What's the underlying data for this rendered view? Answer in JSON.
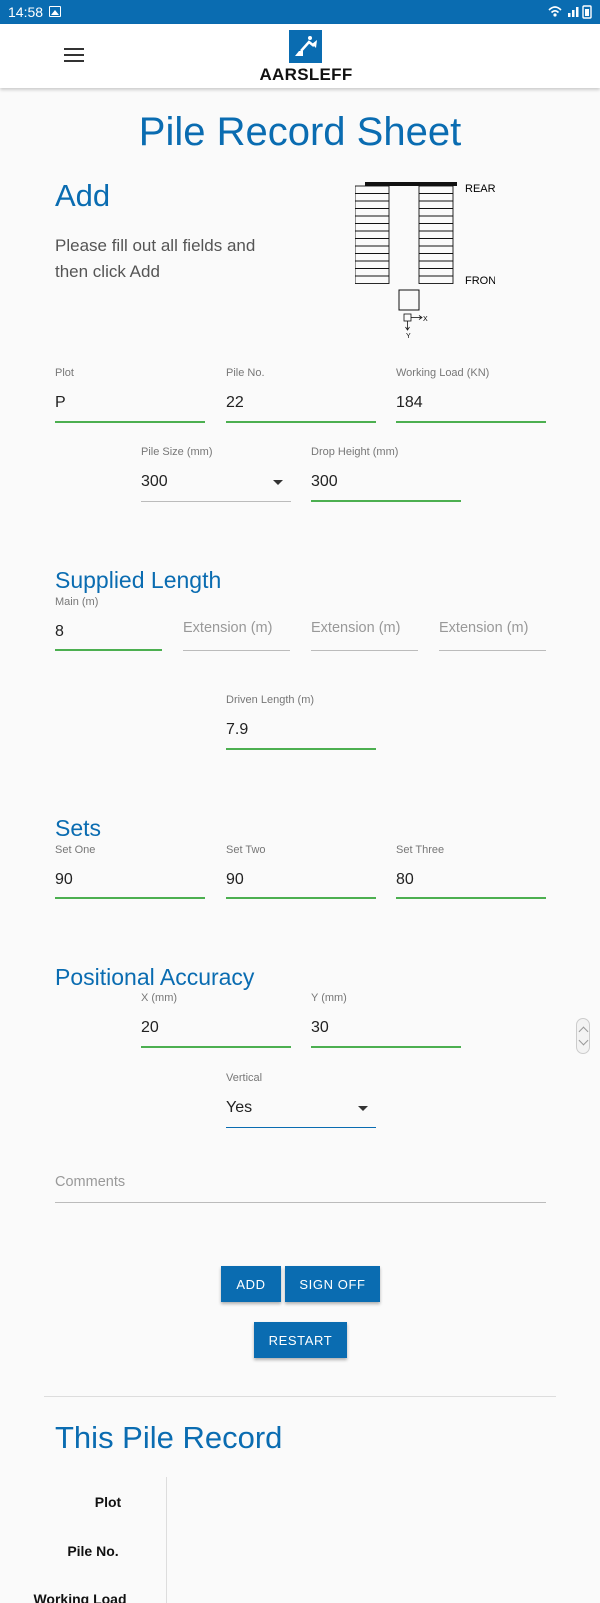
{
  "status_bar": {
    "time": "14:58"
  },
  "header": {
    "brand": "AARSLEFF"
  },
  "page_title": "Pile Record Sheet",
  "add_section": {
    "heading": "Add",
    "instructions": "Please fill out all fields and then click Add",
    "diagram": {
      "rear_label": "REAR",
      "front_label": "FRONT",
      "x_label": "X",
      "y_label": "Y"
    }
  },
  "fields": {
    "plot": {
      "label": "Plot",
      "value": "P"
    },
    "pile_no": {
      "label": "Pile No.",
      "value": "22"
    },
    "working_load": {
      "label": "Working Load (KN)",
      "value": "184"
    },
    "pile_size": {
      "label": "Pile Size (mm)",
      "value": "300"
    },
    "drop_height": {
      "label": "Drop Height (mm)",
      "value": "300"
    }
  },
  "supplied_length": {
    "heading": "Supplied Length",
    "main": {
      "label": "Main (m)",
      "value": "8"
    },
    "extension_placeholder": "Extension (m)",
    "driven_length": {
      "label": "Driven Length (m)",
      "value": "7.9"
    }
  },
  "sets": {
    "heading": "Sets",
    "set_one": {
      "label": "Set One",
      "value": "90"
    },
    "set_two": {
      "label": "Set Two",
      "value": "90"
    },
    "set_three": {
      "label": "Set Three",
      "value": "80"
    }
  },
  "positional_accuracy": {
    "heading": "Positional Accuracy",
    "x": {
      "label": "X (mm)",
      "value": "20"
    },
    "y": {
      "label": "Y (mm)",
      "value": "30"
    },
    "vertical": {
      "label": "Vertical",
      "value": "Yes"
    }
  },
  "comments": {
    "placeholder": "Comments"
  },
  "buttons": {
    "add": "ADD",
    "sign_off": "SIGN OFF",
    "restart": "RESTART"
  },
  "record": {
    "heading": "This Pile Record",
    "labels": [
      "Plot",
      "Pile No.",
      "Working Load"
    ]
  },
  "colors": {
    "brand_blue": "#0a6cb1",
    "valid_green": "#4caf50"
  }
}
